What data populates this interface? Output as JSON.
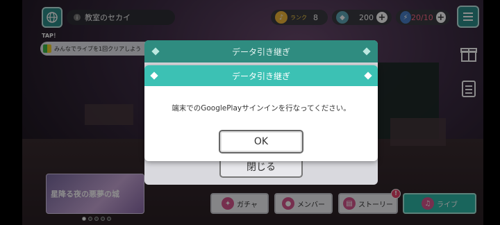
{
  "top_bar": {
    "location": "教室のセカイ",
    "rank_label": "ランク",
    "rank_value": "8",
    "crystals": "200",
    "energy": "20/10"
  },
  "mission": {
    "tap_label": "TAP！",
    "text": "みんなでライブを1回クリアしよう"
  },
  "banner": {
    "text": "星降る夜の悪夢の城"
  },
  "bottom_nav": {
    "gacha": "ガチャ",
    "member": "メンバー",
    "story": "ストーリー",
    "story_badge": "!",
    "live": "ライブ"
  },
  "dialog_back": {
    "title": "データ引き継ぎ",
    "close_label": "閉じる"
  },
  "dialog_front": {
    "title": "データ引き継ぎ",
    "message": "端末でのGooglePlayサインインを行なってください。",
    "ok_label": "OK"
  },
  "colors": {
    "teal_header": "#3cc1b4",
    "teal_header_dark": "#2f8c80",
    "live_button": "#2fb8a8"
  }
}
